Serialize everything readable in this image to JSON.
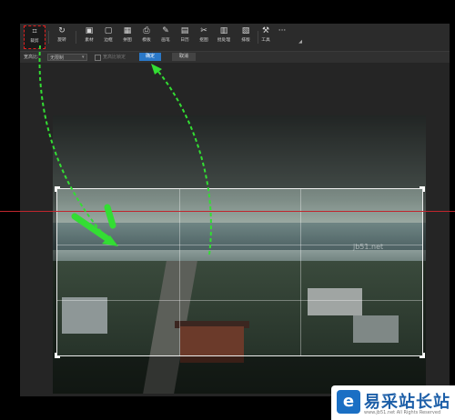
{
  "toolbar": {
    "tools": [
      {
        "label": "裁剪",
        "icon": "crop-icon",
        "glyph": "⌗",
        "active": true
      },
      {
        "label": "旋转",
        "icon": "rotate-icon",
        "glyph": "↻"
      },
      {
        "label": "素材",
        "icon": "sticker-icon",
        "glyph": "▣"
      },
      {
        "label": "边框",
        "icon": "frame-icon",
        "glyph": "▢"
      },
      {
        "label": "拼图",
        "icon": "collage-icon",
        "glyph": "▦"
      },
      {
        "label": "模板",
        "icon": "template-icon",
        "glyph": "⎙"
      },
      {
        "label": "画笔",
        "icon": "brush-icon",
        "glyph": "✎"
      },
      {
        "label": "日历",
        "icon": "calendar-icon",
        "glyph": "▤"
      },
      {
        "label": "抠图",
        "icon": "cutout-icon",
        "glyph": "✂"
      },
      {
        "label": "批处理",
        "icon": "batch-icon",
        "glyph": "▥"
      },
      {
        "label": "排版",
        "icon": "layout-icon",
        "glyph": "▧"
      },
      {
        "label": "工具",
        "icon": "wrench-icon",
        "glyph": "⚒"
      },
      {
        "label": "",
        "icon": "more-icon",
        "glyph": "···"
      }
    ]
  },
  "options": {
    "ratio_label": "宽高比:",
    "ratio_value": "无限制",
    "lock_label": "宽高比锁定",
    "confirm": "确定",
    "cancel": "取消"
  },
  "watermark": "jb51.net",
  "logo": {
    "mark": "e",
    "text": "易采站长站",
    "url": "www.jb51.net  All Rights Reserved"
  },
  "colors": {
    "crop_highlight": "#e02020",
    "confirm_button": "#2a78c8",
    "annotation_arrow": "#33dd33",
    "guide_line": "#c0262d"
  }
}
